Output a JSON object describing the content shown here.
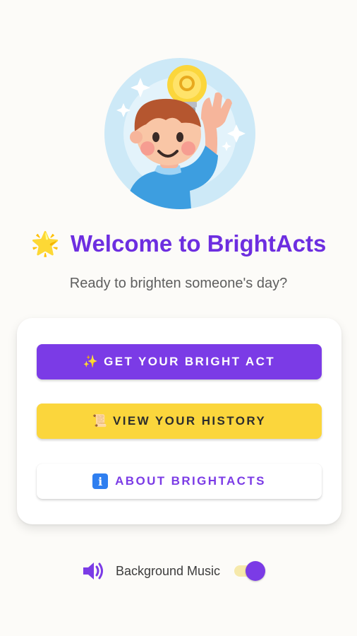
{
  "hero": {
    "illustration": "boy-with-lightbulb-idea"
  },
  "header": {
    "title_emoji": "🌟",
    "title": "Welcome to BrightActs",
    "subtitle": "Ready to brighten someone's day?"
  },
  "menu": {
    "get_act": {
      "icon": "✨",
      "label": "GET YOUR BRIGHT ACT"
    },
    "history": {
      "icon": "📜",
      "label": "VIEW YOUR HISTORY"
    },
    "about": {
      "icon": "i",
      "label": "ABOUT BRIGHTACTS"
    }
  },
  "settings": {
    "music_label": "Background Music",
    "music_enabled": true
  },
  "colors": {
    "primary": "#7b3be6",
    "accent_yellow": "#fbd63c",
    "background": "#fcfbf8"
  }
}
